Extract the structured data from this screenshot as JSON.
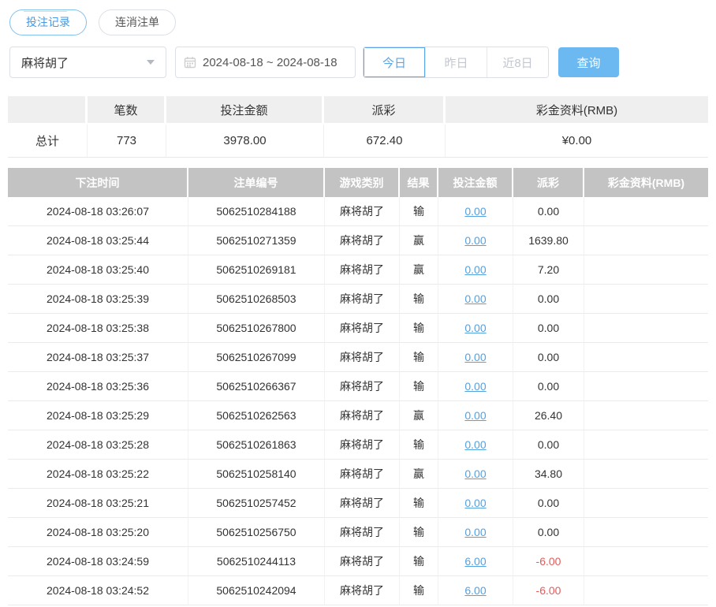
{
  "tabs": {
    "record_label": "投注记录",
    "cancel_label": "连消注单"
  },
  "filters": {
    "game_select_value": "麻将胡了",
    "date_range": "2024-08-18 ~ 2024-08-18",
    "quick_buttons": [
      {
        "label": "今日",
        "active": true
      },
      {
        "label": "昨日",
        "active": false
      },
      {
        "label": "近8日",
        "active": false
      }
    ],
    "search_label": "查询"
  },
  "summary": {
    "headers": [
      "",
      "笔数",
      "投注金额",
      "派彩",
      "彩金资料(RMB)"
    ],
    "row": {
      "label": "总计",
      "count": "773",
      "bet_amount": "3978.00",
      "payout": "672.40",
      "bonus": "¥0.00"
    }
  },
  "table": {
    "headers": [
      "下注时间",
      "注单编号",
      "游戏类别",
      "结果",
      "投注金额",
      "派彩",
      "彩金资料(RMB)"
    ],
    "rows": [
      {
        "time": "2024-08-18 03:26:07",
        "order_no": "5062510284188",
        "game": "麻将胡了",
        "result": "输",
        "bet": "0.00",
        "payout": "0.00",
        "bonus": ""
      },
      {
        "time": "2024-08-18 03:25:44",
        "order_no": "5062510271359",
        "game": "麻将胡了",
        "result": "赢",
        "bet": "0.00",
        "payout": "1639.80",
        "bonus": ""
      },
      {
        "time": "2024-08-18 03:25:40",
        "order_no": "5062510269181",
        "game": "麻将胡了",
        "result": "赢",
        "bet": "0.00",
        "payout": "7.20",
        "bonus": ""
      },
      {
        "time": "2024-08-18 03:25:39",
        "order_no": "5062510268503",
        "game": "麻将胡了",
        "result": "输",
        "bet": "0.00",
        "payout": "0.00",
        "bonus": ""
      },
      {
        "time": "2024-08-18 03:25:38",
        "order_no": "5062510267800",
        "game": "麻将胡了",
        "result": "输",
        "bet": "0.00",
        "payout": "0.00",
        "bonus": ""
      },
      {
        "time": "2024-08-18 03:25:37",
        "order_no": "5062510267099",
        "game": "麻将胡了",
        "result": "输",
        "bet": "0.00",
        "payout": "0.00",
        "bonus": ""
      },
      {
        "time": "2024-08-18 03:25:36",
        "order_no": "5062510266367",
        "game": "麻将胡了",
        "result": "输",
        "bet": "0.00",
        "payout": "0.00",
        "bonus": ""
      },
      {
        "time": "2024-08-18 03:25:29",
        "order_no": "5062510262563",
        "game": "麻将胡了",
        "result": "赢",
        "bet": "0.00",
        "payout": "26.40",
        "bonus": ""
      },
      {
        "time": "2024-08-18 03:25:28",
        "order_no": "5062510261863",
        "game": "麻将胡了",
        "result": "输",
        "bet": "0.00",
        "payout": "0.00",
        "bonus": ""
      },
      {
        "time": "2024-08-18 03:25:22",
        "order_no": "5062510258140",
        "game": "麻将胡了",
        "result": "赢",
        "bet": "0.00",
        "payout": "34.80",
        "bonus": ""
      },
      {
        "time": "2024-08-18 03:25:21",
        "order_no": "5062510257452",
        "game": "麻将胡了",
        "result": "输",
        "bet": "0.00",
        "payout": "0.00",
        "bonus": ""
      },
      {
        "time": "2024-08-18 03:25:20",
        "order_no": "5062510256750",
        "game": "麻将胡了",
        "result": "输",
        "bet": "0.00",
        "payout": "0.00",
        "bonus": ""
      },
      {
        "time": "2024-08-18 03:24:59",
        "order_no": "5062510244113",
        "game": "麻将胡了",
        "result": "输",
        "bet": "6.00",
        "payout": "-6.00",
        "bonus": ""
      },
      {
        "time": "2024-08-18 03:24:52",
        "order_no": "5062510242094",
        "game": "麻将胡了",
        "result": "输",
        "bet": "6.00",
        "payout": "-6.00",
        "bonus": ""
      }
    ]
  },
  "colors": {
    "accent_blue": "#459ae4",
    "link_blue": "#55a1e0",
    "search_button_bg": "#6cb8f1",
    "table_header_bg": "#c3c3c3",
    "summary_header_bg": "#efefef",
    "negative_red": "#e25c5c"
  }
}
